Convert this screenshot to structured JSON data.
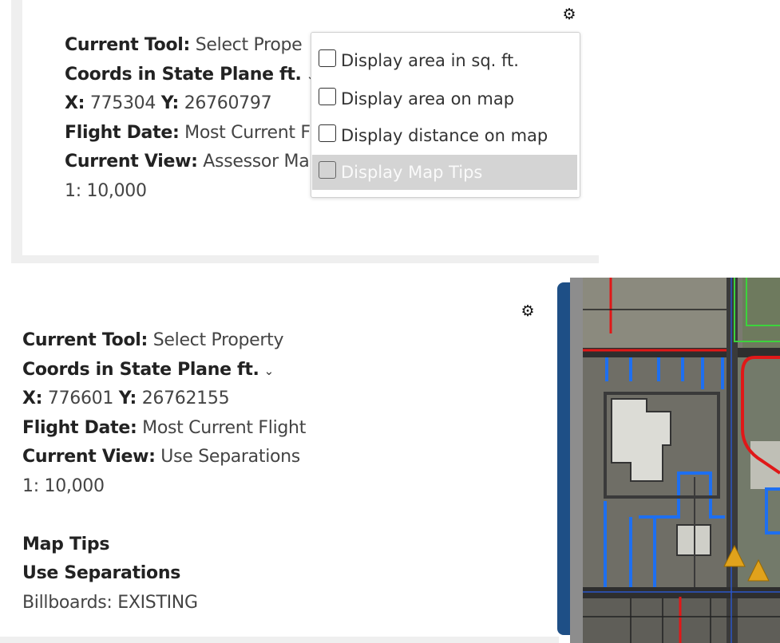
{
  "top_panel": {
    "current_tool_label": "Current Tool:",
    "current_tool_value": "Select Prope",
    "coords_label": "Coords in  State Plane ft.",
    "x_label": "X:",
    "x_value": "775304",
    "y_label": "Y:",
    "y_value": "26760797",
    "flight_date_label": "Flight Date:",
    "flight_date_value": "Most Current F",
    "current_view_label": "Current View:",
    "current_view_value": "Assessor Ma",
    "scale": "1: 10,000",
    "options_menu": {
      "items": [
        {
          "label": "Display area in sq. ft.",
          "checked": false
        },
        {
          "label": "Display area on map",
          "checked": false
        },
        {
          "label": "Display distance on map",
          "checked": false
        },
        {
          "label": "Display Map Tips",
          "checked": false,
          "highlighted": true
        }
      ]
    }
  },
  "bottom_panel": {
    "current_tool_label": "Current Tool:",
    "current_tool_value": "Select Property",
    "coords_label": "Coords in  State Plane ft.",
    "x_label": "X:",
    "x_value": "776601",
    "y_label": "Y:",
    "y_value": "26762155",
    "flight_date_label": "Flight Date:",
    "flight_date_value": "Most Current Flight",
    "current_view_label": "Current View:",
    "current_view_value": "Use Separations",
    "scale": "1: 10,000",
    "map_tips_heading": "Map Tips",
    "map_tips_layer": "Use Separations",
    "map_tips_field_label": "Billboards:",
    "map_tips_field_value": "EXISTING"
  },
  "icons": {
    "settings": "gear-icon",
    "coords_dropdown": "chevron-down-icon"
  },
  "colors": {
    "collapse_bar": "#1e4f86",
    "menu_highlight": "#d4d4d4"
  }
}
